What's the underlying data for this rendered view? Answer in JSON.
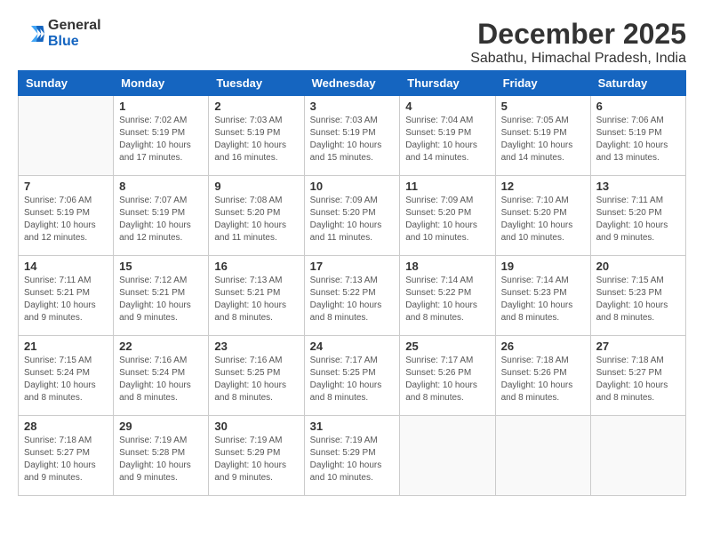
{
  "app": {
    "logo_general": "General",
    "logo_blue": "Blue"
  },
  "header": {
    "month": "December 2025",
    "location": "Sabathu, Himachal Pradesh, India"
  },
  "weekdays": [
    "Sunday",
    "Monday",
    "Tuesday",
    "Wednesday",
    "Thursday",
    "Friday",
    "Saturday"
  ],
  "weeks": [
    [
      {
        "day": "",
        "info": ""
      },
      {
        "day": "1",
        "info": "Sunrise: 7:02 AM\nSunset: 5:19 PM\nDaylight: 10 hours\nand 17 minutes."
      },
      {
        "day": "2",
        "info": "Sunrise: 7:03 AM\nSunset: 5:19 PM\nDaylight: 10 hours\nand 16 minutes."
      },
      {
        "day": "3",
        "info": "Sunrise: 7:03 AM\nSunset: 5:19 PM\nDaylight: 10 hours\nand 15 minutes."
      },
      {
        "day": "4",
        "info": "Sunrise: 7:04 AM\nSunset: 5:19 PM\nDaylight: 10 hours\nand 14 minutes."
      },
      {
        "day": "5",
        "info": "Sunrise: 7:05 AM\nSunset: 5:19 PM\nDaylight: 10 hours\nand 14 minutes."
      },
      {
        "day": "6",
        "info": "Sunrise: 7:06 AM\nSunset: 5:19 PM\nDaylight: 10 hours\nand 13 minutes."
      }
    ],
    [
      {
        "day": "7",
        "info": "Sunrise: 7:06 AM\nSunset: 5:19 PM\nDaylight: 10 hours\nand 12 minutes."
      },
      {
        "day": "8",
        "info": "Sunrise: 7:07 AM\nSunset: 5:19 PM\nDaylight: 10 hours\nand 12 minutes."
      },
      {
        "day": "9",
        "info": "Sunrise: 7:08 AM\nSunset: 5:20 PM\nDaylight: 10 hours\nand 11 minutes."
      },
      {
        "day": "10",
        "info": "Sunrise: 7:09 AM\nSunset: 5:20 PM\nDaylight: 10 hours\nand 11 minutes."
      },
      {
        "day": "11",
        "info": "Sunrise: 7:09 AM\nSunset: 5:20 PM\nDaylight: 10 hours\nand 10 minutes."
      },
      {
        "day": "12",
        "info": "Sunrise: 7:10 AM\nSunset: 5:20 PM\nDaylight: 10 hours\nand 10 minutes."
      },
      {
        "day": "13",
        "info": "Sunrise: 7:11 AM\nSunset: 5:20 PM\nDaylight: 10 hours\nand 9 minutes."
      }
    ],
    [
      {
        "day": "14",
        "info": "Sunrise: 7:11 AM\nSunset: 5:21 PM\nDaylight: 10 hours\nand 9 minutes."
      },
      {
        "day": "15",
        "info": "Sunrise: 7:12 AM\nSunset: 5:21 PM\nDaylight: 10 hours\nand 9 minutes."
      },
      {
        "day": "16",
        "info": "Sunrise: 7:13 AM\nSunset: 5:21 PM\nDaylight: 10 hours\nand 8 minutes."
      },
      {
        "day": "17",
        "info": "Sunrise: 7:13 AM\nSunset: 5:22 PM\nDaylight: 10 hours\nand 8 minutes."
      },
      {
        "day": "18",
        "info": "Sunrise: 7:14 AM\nSunset: 5:22 PM\nDaylight: 10 hours\nand 8 minutes."
      },
      {
        "day": "19",
        "info": "Sunrise: 7:14 AM\nSunset: 5:23 PM\nDaylight: 10 hours\nand 8 minutes."
      },
      {
        "day": "20",
        "info": "Sunrise: 7:15 AM\nSunset: 5:23 PM\nDaylight: 10 hours\nand 8 minutes."
      }
    ],
    [
      {
        "day": "21",
        "info": "Sunrise: 7:15 AM\nSunset: 5:24 PM\nDaylight: 10 hours\nand 8 minutes."
      },
      {
        "day": "22",
        "info": "Sunrise: 7:16 AM\nSunset: 5:24 PM\nDaylight: 10 hours\nand 8 minutes."
      },
      {
        "day": "23",
        "info": "Sunrise: 7:16 AM\nSunset: 5:25 PM\nDaylight: 10 hours\nand 8 minutes."
      },
      {
        "day": "24",
        "info": "Sunrise: 7:17 AM\nSunset: 5:25 PM\nDaylight: 10 hours\nand 8 minutes."
      },
      {
        "day": "25",
        "info": "Sunrise: 7:17 AM\nSunset: 5:26 PM\nDaylight: 10 hours\nand 8 minutes."
      },
      {
        "day": "26",
        "info": "Sunrise: 7:18 AM\nSunset: 5:26 PM\nDaylight: 10 hours\nand 8 minutes."
      },
      {
        "day": "27",
        "info": "Sunrise: 7:18 AM\nSunset: 5:27 PM\nDaylight: 10 hours\nand 8 minutes."
      }
    ],
    [
      {
        "day": "28",
        "info": "Sunrise: 7:18 AM\nSunset: 5:27 PM\nDaylight: 10 hours\nand 9 minutes."
      },
      {
        "day": "29",
        "info": "Sunrise: 7:19 AM\nSunset: 5:28 PM\nDaylight: 10 hours\nand 9 minutes."
      },
      {
        "day": "30",
        "info": "Sunrise: 7:19 AM\nSunset: 5:29 PM\nDaylight: 10 hours\nand 9 minutes."
      },
      {
        "day": "31",
        "info": "Sunrise: 7:19 AM\nSunset: 5:29 PM\nDaylight: 10 hours\nand 10 minutes."
      },
      {
        "day": "",
        "info": ""
      },
      {
        "day": "",
        "info": ""
      },
      {
        "day": "",
        "info": ""
      }
    ]
  ]
}
